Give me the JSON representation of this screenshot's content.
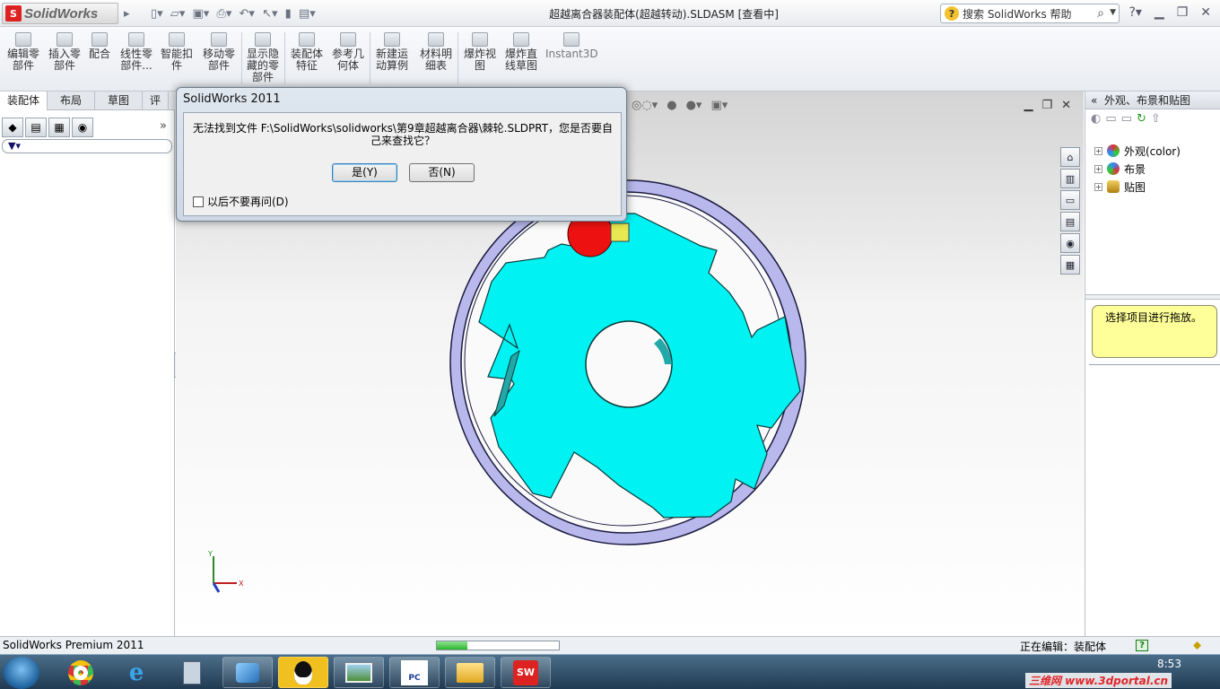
{
  "app": {
    "logo_text": "SolidWorks",
    "window_title": "超越离合器装配体(超越转动).SLDASM [查看中]",
    "help_search_placeholder": "搜索 SolidWorks 帮助"
  },
  "commands": [
    {
      "id": "edit-component",
      "label": "编辑零部件"
    },
    {
      "id": "insert-component",
      "label": "插入零部件"
    },
    {
      "id": "mate",
      "label": "配合"
    },
    {
      "id": "linear-pattern",
      "label": "线性零部件..."
    },
    {
      "id": "smart-fasteners",
      "label": "智能扣件"
    },
    {
      "id": "move-component",
      "label": "移动零部件"
    },
    {
      "id": "show-hidden",
      "label": "显示隐藏的零部件"
    },
    {
      "id": "assembly-features",
      "label": "装配体特征"
    },
    {
      "id": "reference-geometry",
      "label": "参考几何体"
    },
    {
      "id": "new-motion-study",
      "label": "新建运动算例"
    },
    {
      "id": "bom",
      "label": "材料明细表"
    },
    {
      "id": "exploded-view",
      "label": "爆炸视图"
    },
    {
      "id": "explode-line-sketch",
      "label": "爆炸直线草图"
    },
    {
      "id": "instant3d",
      "label": "Instant3D"
    }
  ],
  "left_tabs": [
    "装配体",
    "布局",
    "草图",
    "评"
  ],
  "dialog": {
    "title": "SolidWorks 2011",
    "message": "无法找到文件 F:\\SolidWorks\\solidworks\\第9章超越离合器\\棘轮.SLDPRT，您是否要自己来查找它？",
    "yes_label": "是(Y)",
    "no_label": "否(N)",
    "checkbox_label": "以后不要再问(D)",
    "checkbox_checked": false
  },
  "task_pane": {
    "title": "外观、布景和贴图",
    "tree": [
      {
        "label": "外观(color)",
        "color": "#3aa0e0"
      },
      {
        "label": "布景",
        "color": "#d04040"
      },
      {
        "label": "贴图",
        "color": "#e0b030"
      }
    ],
    "hint": "选择项目进行拖放。"
  },
  "triad": {
    "x_label": "X",
    "y_label": "Y"
  },
  "status": {
    "left": "SolidWorks Premium 2011",
    "right": "正在编辑：装配体",
    "progress": 0.25,
    "help_icon_text": "?"
  },
  "taskbar": {
    "clock": "8:53",
    "watermark": "三维网 www.3dportal.cn",
    "apps": [
      "chrome",
      "ie",
      "calculator",
      "windows-mobile",
      "qq",
      "photo-viewer",
      "pc-cad",
      "explorer",
      "solidworks"
    ],
    "pc_cad_label": "PC CAD",
    "solidworks_label": "SW"
  },
  "colors": {
    "part_fill": "#00f2f2",
    "ring_fill": "#b8b8ec",
    "ring_stroke": "#1a1a40",
    "ball_red": "#ee1111",
    "pin_yellow": "#e8e850"
  }
}
